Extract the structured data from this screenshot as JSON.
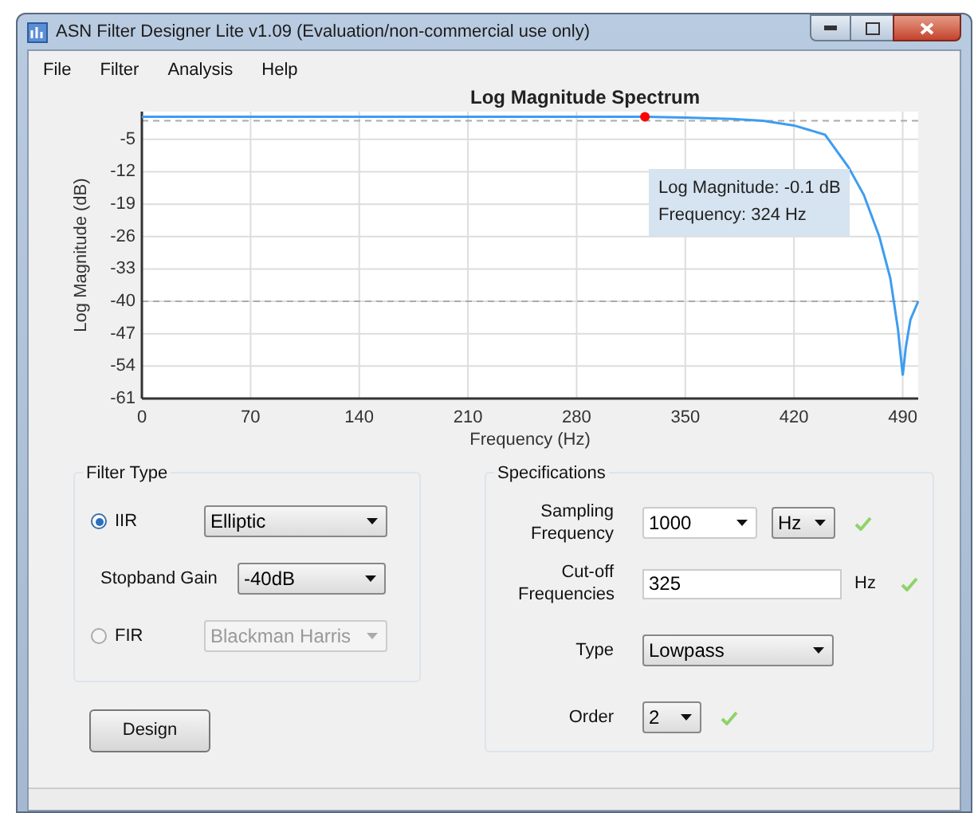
{
  "window": {
    "title": "ASN Filter Designer Lite v1.09 (Evaluation/non-commercial use only)"
  },
  "menu": [
    "File",
    "Filter",
    "Analysis",
    "Help"
  ],
  "chart": {
    "chart_data": {
      "type": "line",
      "title": "Log Magnitude Spectrum",
      "xlabel": "Frequency (Hz)",
      "ylabel": "Log Magnitude (dB)",
      "x": [
        0,
        50,
        100,
        150,
        200,
        250,
        300,
        324,
        350,
        380,
        400,
        420,
        440,
        455,
        465,
        475,
        482,
        487,
        490,
        492,
        495,
        500
      ],
      "series": [
        {
          "color": "#3d9df0",
          "values": [
            -0.1,
            -0.1,
            -0.1,
            -0.1,
            -0.1,
            -0.1,
            -0.1,
            -0.1,
            -0.3,
            -0.6,
            -1,
            -2,
            -4,
            -11,
            -17,
            -26,
            -35,
            -46,
            -56,
            -50,
            -44,
            -40
          ]
        }
      ],
      "xlim": [
        0,
        500
      ],
      "ylim": [
        -61,
        1
      ],
      "xticks": [
        0,
        70,
        140,
        210,
        280,
        350,
        420,
        490
      ],
      "yticks": [
        -5,
        -12,
        -19,
        -26,
        -33,
        -40,
        -47,
        -54,
        -61
      ],
      "grid": true,
      "ref_lines": [
        {
          "axis": "y",
          "value": -1
        },
        {
          "axis": "y",
          "value": -40
        }
      ]
    },
    "tooltip": [
      "Log Magnitude: -0.1 dB",
      "Frequency: 324 Hz"
    ]
  },
  "filter_type": {
    "title": "Filter Type",
    "options": [
      {
        "label": "IIR",
        "selected": true,
        "dropdown": "Elliptic",
        "disabled": false
      },
      {
        "label": "FIR",
        "selected": false,
        "dropdown": "Blackman Harris",
        "disabled": true
      }
    ],
    "stopband_gain": {
      "label": "Stopband Gain",
      "value": "-40dB"
    }
  },
  "design_button": "Design",
  "specifications": {
    "title": "Specifications",
    "sampling_frequency": {
      "label": "Sampling Frequency",
      "value": "1000",
      "unit": "Hz",
      "valid": true
    },
    "cutoff": {
      "label": "Cut-off Frequencies",
      "value": "325",
      "unit": "Hz",
      "valid": true
    },
    "type": {
      "label": "Type",
      "value": "Lowpass"
    },
    "order": {
      "label": "Order",
      "value": "2",
      "valid": true
    }
  }
}
